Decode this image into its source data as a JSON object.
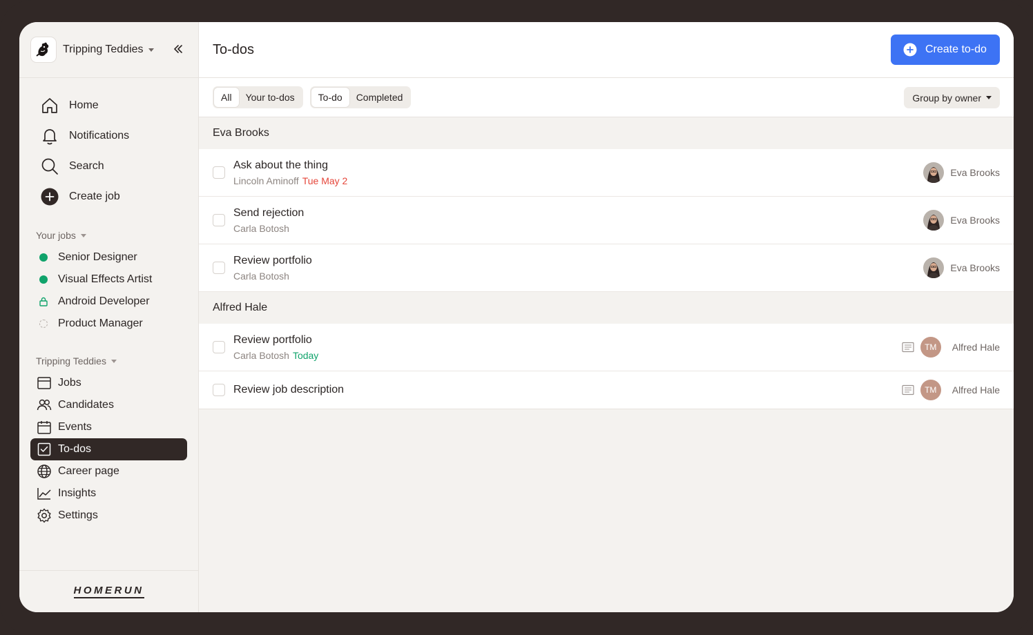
{
  "org": {
    "name": "Tripping Teddies"
  },
  "main_nav": [
    {
      "label": "Home",
      "icon": "home-icon"
    },
    {
      "label": "Notifications",
      "icon": "bell-icon"
    },
    {
      "label": "Search",
      "icon": "search-icon"
    },
    {
      "label": "Create job",
      "icon": "plus-circle-icon"
    }
  ],
  "your_jobs": {
    "header": "Your jobs",
    "items": [
      {
        "label": "Senior Designer",
        "status": "published",
        "color": "#10a36b"
      },
      {
        "label": "Visual Effects Artist",
        "status": "published",
        "color": "#10a36b"
      },
      {
        "label": "Android Developer",
        "status": "internal",
        "color": "#10a36b"
      },
      {
        "label": "Product Manager",
        "status": "draft",
        "color": "#b7b0ab"
      }
    ]
  },
  "org_section": {
    "header": "Tripping Teddies",
    "items": [
      {
        "label": "Jobs",
        "icon": "jobs-icon"
      },
      {
        "label": "Candidates",
        "icon": "candidates-icon"
      },
      {
        "label": "Events",
        "icon": "calendar-icon"
      },
      {
        "label": "To-dos",
        "icon": "checkbox-icon",
        "active": true
      },
      {
        "label": "Career page",
        "icon": "globe-icon"
      },
      {
        "label": "Insights",
        "icon": "chart-icon"
      },
      {
        "label": "Settings",
        "icon": "gear-icon"
      }
    ]
  },
  "brand": "HOMERUN",
  "header": {
    "title": "To-dos",
    "create_button": "Create to-do"
  },
  "filters": {
    "scope": [
      "All",
      "Your to-dos"
    ],
    "scope_selected": "All",
    "status": [
      "To-do",
      "Completed"
    ],
    "status_selected": "To-do",
    "group_by": "Group by owner"
  },
  "groups": [
    {
      "owner": "Eva Brooks",
      "todos": [
        {
          "title": "Ask about the thing",
          "candidate": "Lincoln Aminoff",
          "due": "Tue May 2",
          "due_color": "#e5463a",
          "owner": "Eva Brooks"
        },
        {
          "title": "Send rejection",
          "candidate": "Carla Botosh",
          "owner": "Eva Brooks"
        },
        {
          "title": "Review portfolio",
          "candidate": "Carla Botosh",
          "owner": "Eva Brooks"
        }
      ]
    },
    {
      "owner": "Alfred Hale",
      "todos": [
        {
          "title": "Review portfolio",
          "candidate": "Carla Botosh",
          "due": "Today",
          "due_color": "#10a36b",
          "owner": "Alfred Hale",
          "initials": "TM",
          "has_note": true
        },
        {
          "title": "Review job description",
          "owner": "Alfred Hale",
          "initials": "TM",
          "has_note": true
        }
      ]
    }
  ]
}
